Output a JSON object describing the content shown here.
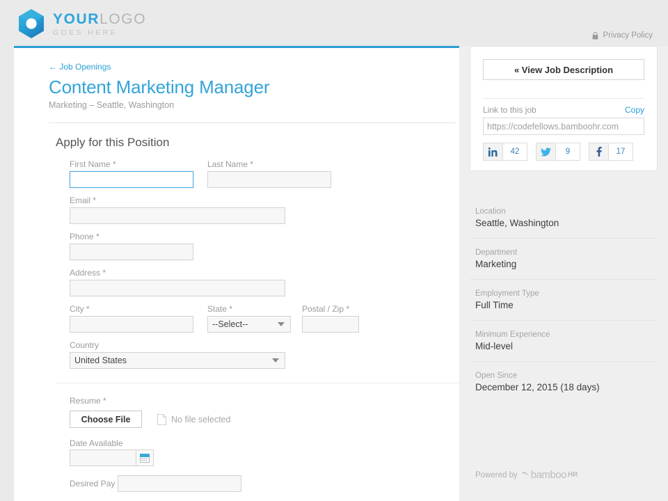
{
  "header": {
    "logo": {
      "icon": "hexagon-logo-icon",
      "line1_primary": "YOUR",
      "line1_secondary": "LOGO",
      "line2": "GOES HERE"
    },
    "privacy": {
      "icon": "lock-icon",
      "label": "Privacy Policy"
    }
  },
  "job": {
    "back_link": "Job Openings",
    "back_arrow": "←",
    "title": "Content Marketing Manager",
    "subtitle": "Marketing – Seattle, Washington"
  },
  "form": {
    "section_title": "Apply for this Position",
    "fields": {
      "first_name": {
        "label": "First Name",
        "required": "*",
        "value": "",
        "focused": true
      },
      "last_name": {
        "label": "Last Name",
        "required": "*",
        "value": ""
      },
      "email": {
        "label": "Email",
        "required": "*",
        "value": ""
      },
      "phone": {
        "label": "Phone",
        "required": "*",
        "value": ""
      },
      "address": {
        "label": "Address",
        "required": "*",
        "value": ""
      },
      "city": {
        "label": "City",
        "required": "*",
        "value": ""
      },
      "state": {
        "label": "State",
        "required": "*",
        "value": "--Select--"
      },
      "postal": {
        "label": "Postal / Zip",
        "required": "*",
        "value": ""
      },
      "country": {
        "label": "Country",
        "required": "",
        "value": "United States"
      },
      "resume": {
        "label": "Resume",
        "required": "*",
        "button": "Choose File",
        "status": "No file selected",
        "file_icon": "document-icon"
      },
      "date_available": {
        "label": "Date Available",
        "required": "",
        "value": "",
        "icon": "calendar-icon"
      },
      "desired_pay": {
        "label": "Desired Pay",
        "required": "",
        "value": ""
      }
    }
  },
  "sidebar": {
    "view_job_button": "« View Job Description",
    "link_label": "Link to this job",
    "copy_label": "Copy",
    "job_url": "https://codefellows.bamboohr.com",
    "social": [
      {
        "network": "linkedin",
        "icon": "linkedin-icon",
        "count": "42"
      },
      {
        "network": "twitter",
        "icon": "twitter-icon",
        "count": "9"
      },
      {
        "network": "facebook",
        "icon": "facebook-icon",
        "count": "17"
      }
    ],
    "details": [
      {
        "label": "Location",
        "value": "Seattle, Washington"
      },
      {
        "label": "Department",
        "value": "Marketing"
      },
      {
        "label": "Employment Type",
        "value": "Full Time"
      },
      {
        "label": "Minimum Experience",
        "value": "Mid-level"
      },
      {
        "label": "Open Since",
        "value": "December 12, 2015 (18 days)"
      }
    ],
    "powered_by": {
      "prefix": "Powered by",
      "brand": "bamboo",
      "brand_suffix": "HR",
      "icon": "bamboo-leaf-icon"
    }
  },
  "colors": {
    "accent_blue": "#2b9ed4",
    "title_blue": "#33a4d8",
    "page_bg": "#eaeaea",
    "sidebar_bg": "#efefef",
    "input_bg": "#f7f7f7",
    "focus_border": "#4aa8dd"
  }
}
